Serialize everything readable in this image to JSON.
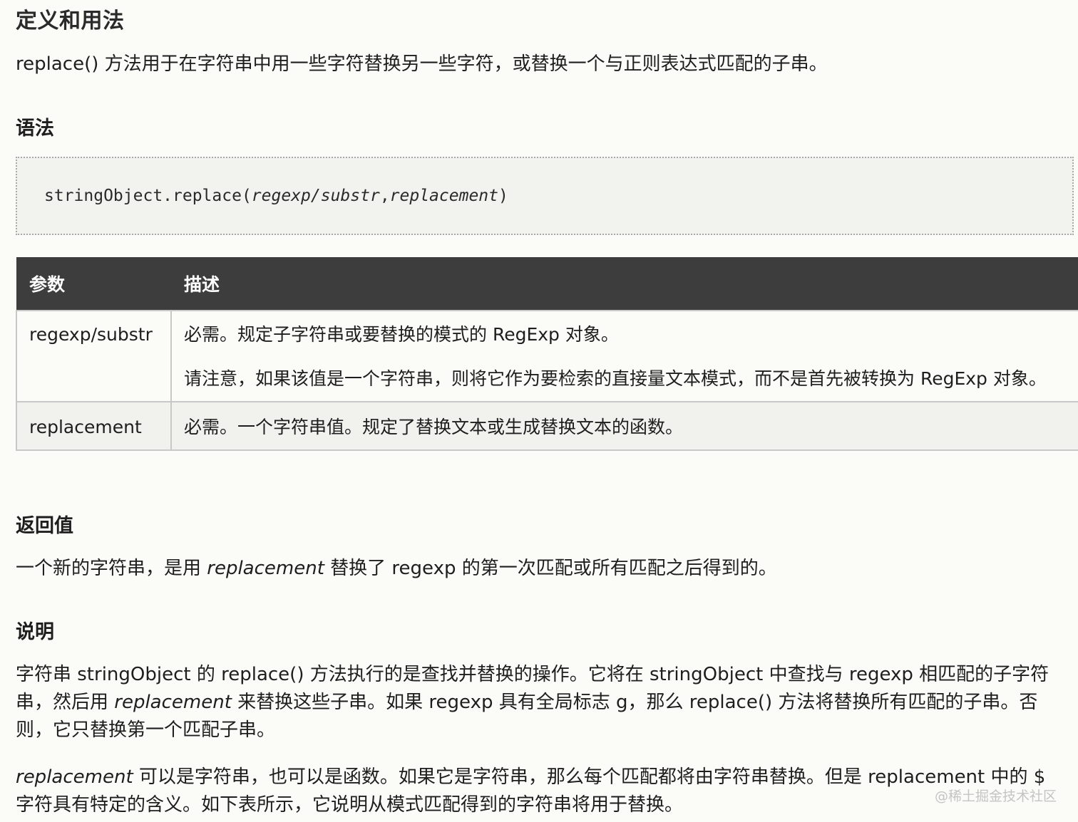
{
  "section_definition": {
    "heading": "定义和用法",
    "text": "replace() 方法用于在字符串中用一些字符替换另一些字符，或替换一个与正则表达式匹配的子串。"
  },
  "section_syntax": {
    "heading": "语法",
    "code_prefix": "stringObject.replace(",
    "code_arg1": "regexp/substr",
    "code_comma": ",",
    "code_arg2": "replacement",
    "code_suffix": ")"
  },
  "params_table": {
    "headers": [
      "参数",
      "描述"
    ],
    "rows": [
      {
        "name": "regexp/substr",
        "desc1": "必需。规定子字符串或要替换的模式的 RegExp 对象。",
        "desc2": "请注意，如果该值是一个字符串，则将它作为要检索的直接量文本模式，而不是首先被转换为 RegExp 对象。"
      },
      {
        "name": "replacement",
        "desc1": "必需。一个字符串值。规定了替换文本或生成替换文本的函数。"
      }
    ]
  },
  "section_return": {
    "heading": "返回值",
    "text_before": "一个新的字符串，是用 ",
    "text_em": "replacement",
    "text_after": " 替换了 regexp 的第一次匹配或所有匹配之后得到的。"
  },
  "section_desc": {
    "heading": "说明",
    "p1_before": "字符串 stringObject 的 replace() 方法执行的是查找并替换的操作。它将在 stringObject 中查找与 regexp 相匹配的子字符串，然后用 ",
    "p1_em": "replacement",
    "p1_after": " 来替换这些子串。如果 regexp 具有全局标志 g，那么 replace() 方法将替换所有匹配的子串。否则，它只替换第一个匹配子串。",
    "p2_em": "replacement",
    "p2_after": " 可以是字符串，也可以是函数。如果它是字符串，那么每个匹配都将由字符串替换。但是 replacement 中的 $ 字符具有特定的含义。如下表所示，它说明从模式匹配得到的字符串将用于替换。"
  },
  "watermark": "@稀土掘金技术社区"
}
